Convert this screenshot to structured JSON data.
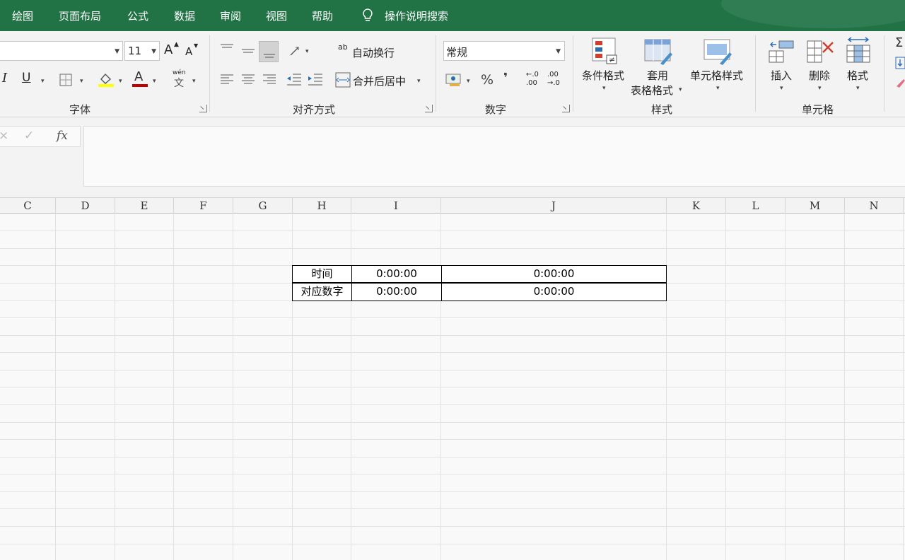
{
  "tabs": [
    "绘图",
    "页面布局",
    "公式",
    "数据",
    "审阅",
    "视图",
    "帮助"
  ],
  "search": {
    "label": "操作说明搜索"
  },
  "font_group": {
    "size": "11",
    "label": "字体",
    "grow_label": "A",
    "shrink_label": "A",
    "italic": "I",
    "underline": "U",
    "font_color_glyph": "A",
    "phonetic_top": "wén",
    "phonetic_bottom": "文"
  },
  "align_group": {
    "wrap_label": "自动换行",
    "merge_label": "合并后居中",
    "label": "对齐方式",
    "wrap_glyph": "ab"
  },
  "number_group": {
    "format": "常规",
    "percent": "%",
    "comma": "❜",
    "inc_decimal_top": "←.0",
    "inc_decimal_bottom": ".00",
    "dec_decimal_top": ".00",
    "dec_decimal_bottom": "→.0",
    "label": "数字"
  },
  "styles_group": {
    "conditional": "条件格式",
    "table_top": "套用",
    "table_bottom": "表格格式",
    "cell_styles": "单元格样式",
    "label": "样式"
  },
  "cells_group": {
    "insert": "插入",
    "delete": "删除",
    "format": "格式",
    "label": "单元格"
  },
  "formula_bar": {
    "fx": "fx",
    "content": ""
  },
  "columns": [
    {
      "name": "C"
    },
    {
      "name": "D"
    },
    {
      "name": "E"
    },
    {
      "name": "F"
    },
    {
      "name": "G"
    },
    {
      "name": "H"
    },
    {
      "name": "I"
    },
    {
      "name": "J"
    },
    {
      "name": "K"
    },
    {
      "name": "L"
    },
    {
      "name": "M"
    },
    {
      "name": "N"
    }
  ],
  "table": {
    "rows": [
      {
        "label": "时间",
        "i": "0:00:00",
        "j": "0:00:00"
      },
      {
        "label": "对应数字",
        "i": "0:00:00",
        "j": "0:00:00"
      }
    ]
  },
  "colors": {
    "accent": "#217346",
    "fill_color": "#ffff00",
    "font_color": "#c00000"
  }
}
